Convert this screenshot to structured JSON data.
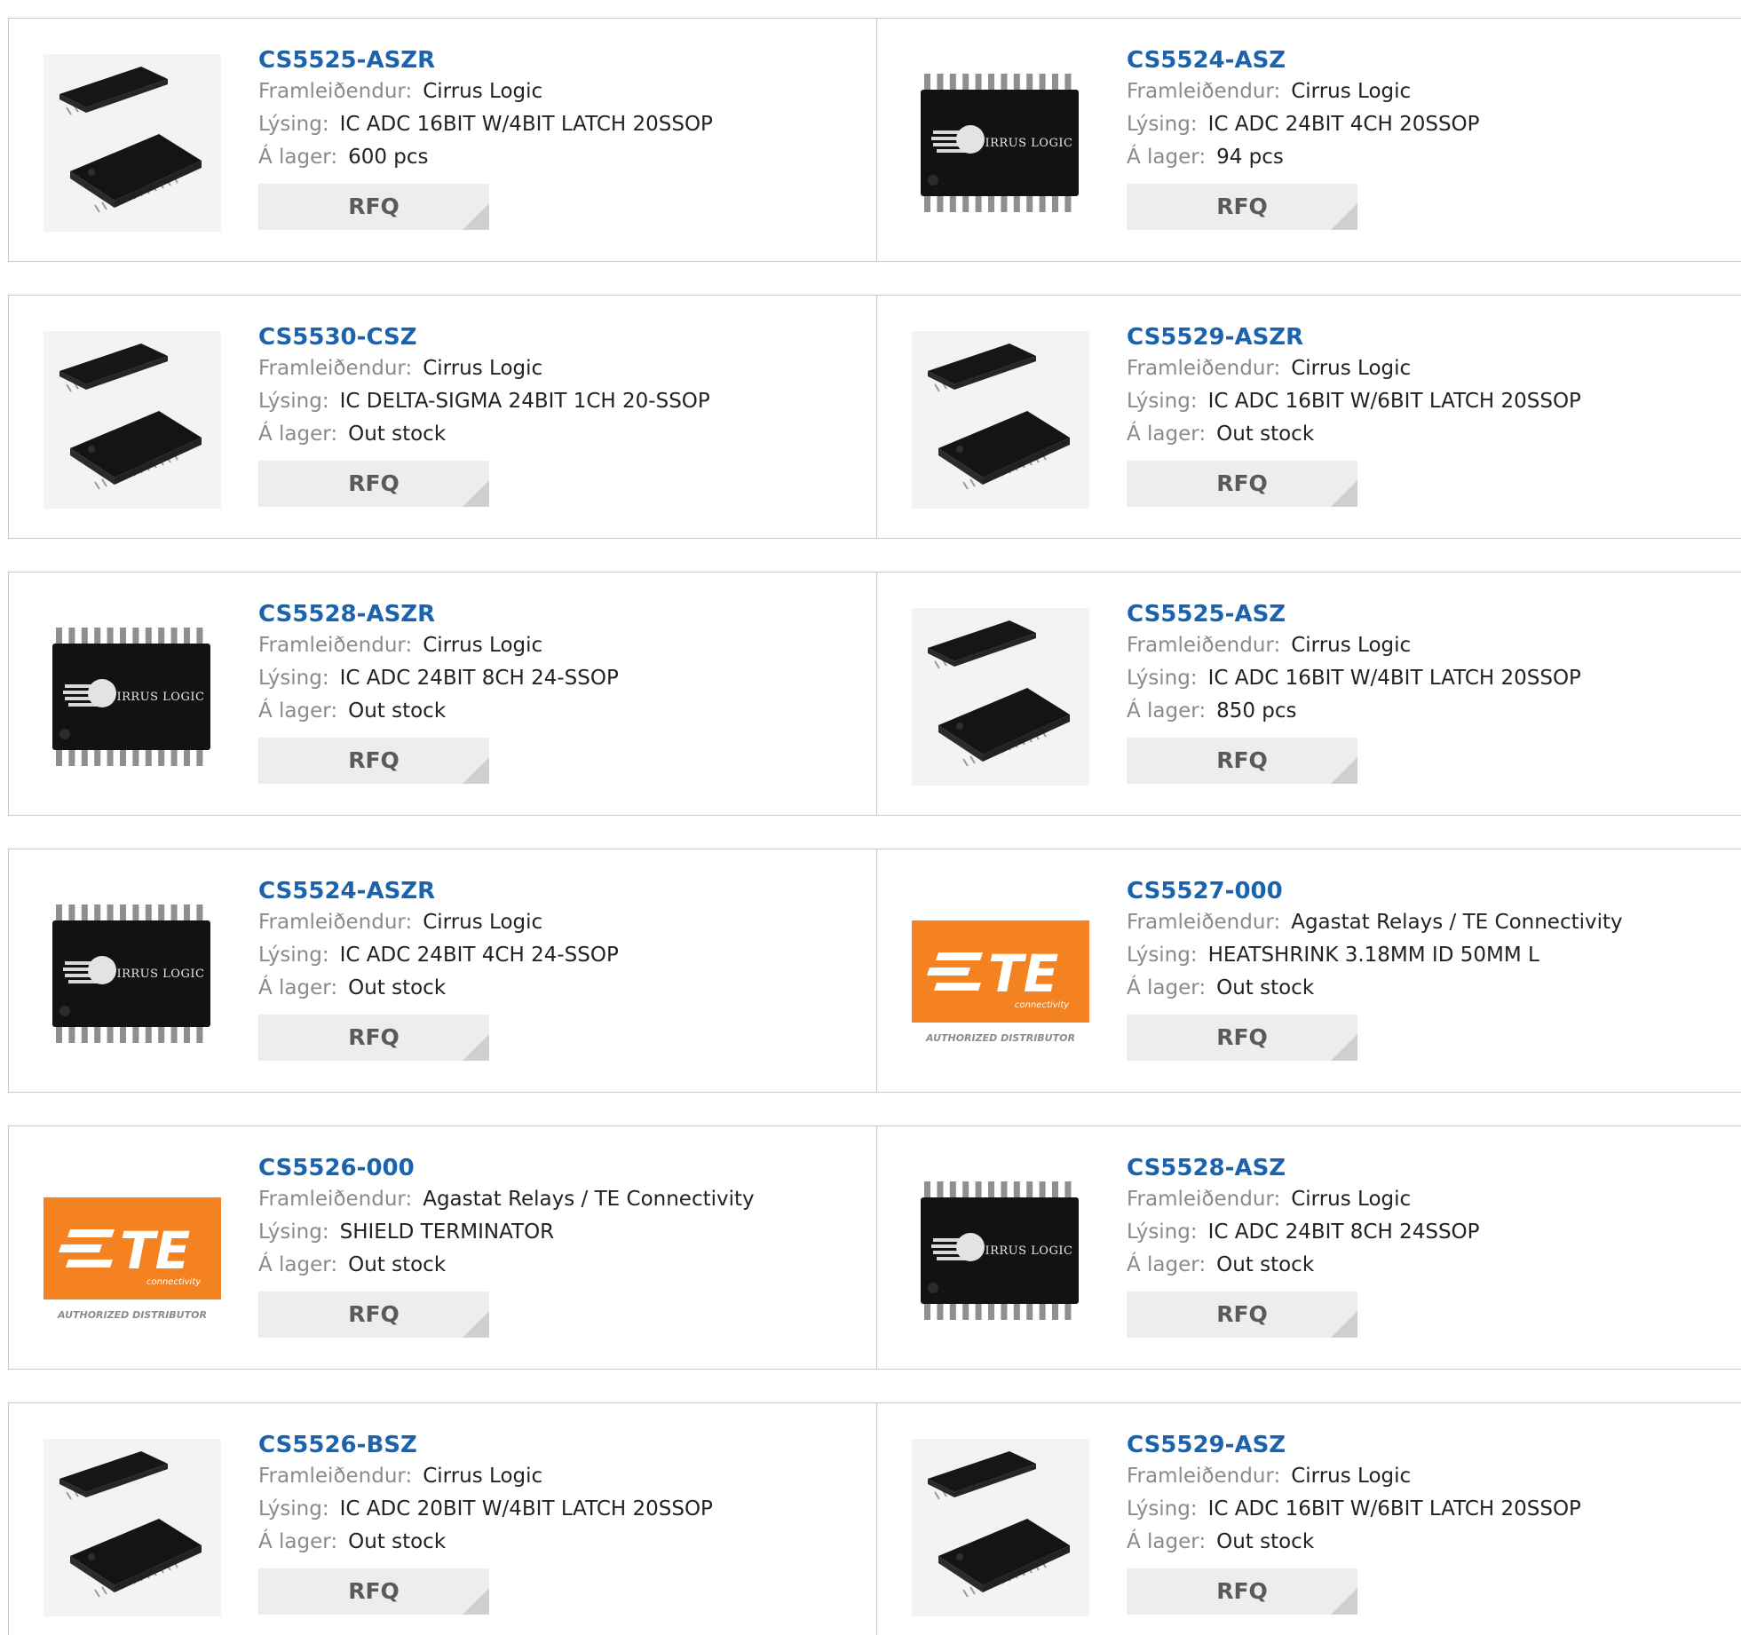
{
  "labels": {
    "manufacturer": "Framleiðendur:",
    "description": "Lýsing:",
    "stock": "Á lager:",
    "rfq": "RFQ"
  },
  "brand": {
    "cirrus_logo_text": "CIRRUS LOGIC",
    "te_logo_text": "TE",
    "te_sub": "connectivity",
    "te_badge": "AUTHORIZED DISTRIBUTOR",
    "te_color": "#f58220",
    "link_color": "#1b63ad"
  },
  "products": [
    {
      "part": "CS5525-ASZR",
      "manufacturer": "Cirrus Logic",
      "description": "IC ADC 16BIT W/4BIT LATCH 20SSOP",
      "stock": "600 pcs",
      "image": "ssop-chip-icon"
    },
    {
      "part": "CS5524-ASZ",
      "manufacturer": "Cirrus Logic",
      "description": "IC ADC 24BIT 4CH 20SSOP",
      "stock": "94 pcs",
      "image": "cirrus-chip-icon"
    },
    {
      "part": "CS5530-CSZ",
      "manufacturer": "Cirrus Logic",
      "description": "IC DELTA-SIGMA 24BIT 1CH 20-SSOP",
      "stock": "Out stock",
      "image": "ssop-chip-icon"
    },
    {
      "part": "CS5529-ASZR",
      "manufacturer": "Cirrus Logic",
      "description": "IC ADC 16BIT W/6BIT LATCH 20SSOP",
      "stock": "Out stock",
      "image": "ssop-chip-icon"
    },
    {
      "part": "CS5528-ASZR",
      "manufacturer": "Cirrus Logic",
      "description": "IC ADC 24BIT 8CH 24-SSOP",
      "stock": "Out stock",
      "image": "cirrus-chip-icon"
    },
    {
      "part": "CS5525-ASZ",
      "manufacturer": "Cirrus Logic",
      "description": "IC ADC 16BIT W/4BIT LATCH 20SSOP",
      "stock": "850 pcs",
      "image": "ssop-chip-icon"
    },
    {
      "part": "CS5524-ASZR",
      "manufacturer": "Cirrus Logic",
      "description": "IC ADC 24BIT 4CH 24-SSOP",
      "stock": "Out stock",
      "image": "cirrus-chip-icon"
    },
    {
      "part": "CS5527-000",
      "manufacturer": "Agastat Relays / TE Connectivity",
      "description": "HEATSHRINK 3.18MM ID 50MM L",
      "stock": "Out stock",
      "image": "te-logo-icon"
    },
    {
      "part": "CS5526-000",
      "manufacturer": "Agastat Relays / TE Connectivity",
      "description": "SHIELD TERMINATOR",
      "stock": "Out stock",
      "image": "te-logo-icon"
    },
    {
      "part": "CS5528-ASZ",
      "manufacturer": "Cirrus Logic",
      "description": "IC ADC 24BIT 8CH 24SSOP",
      "stock": "Out stock",
      "image": "cirrus-chip-icon"
    },
    {
      "part": "CS5526-BSZ",
      "manufacturer": "Cirrus Logic",
      "description": "IC ADC 20BIT W/4BIT LATCH 20SSOP",
      "stock": "Out stock",
      "image": "ssop-chip-icon"
    },
    {
      "part": "CS5529-ASZ",
      "manufacturer": "Cirrus Logic",
      "description": "IC ADC 16BIT W/6BIT LATCH 20SSOP",
      "stock": "Out stock",
      "image": "ssop-chip-icon"
    }
  ]
}
